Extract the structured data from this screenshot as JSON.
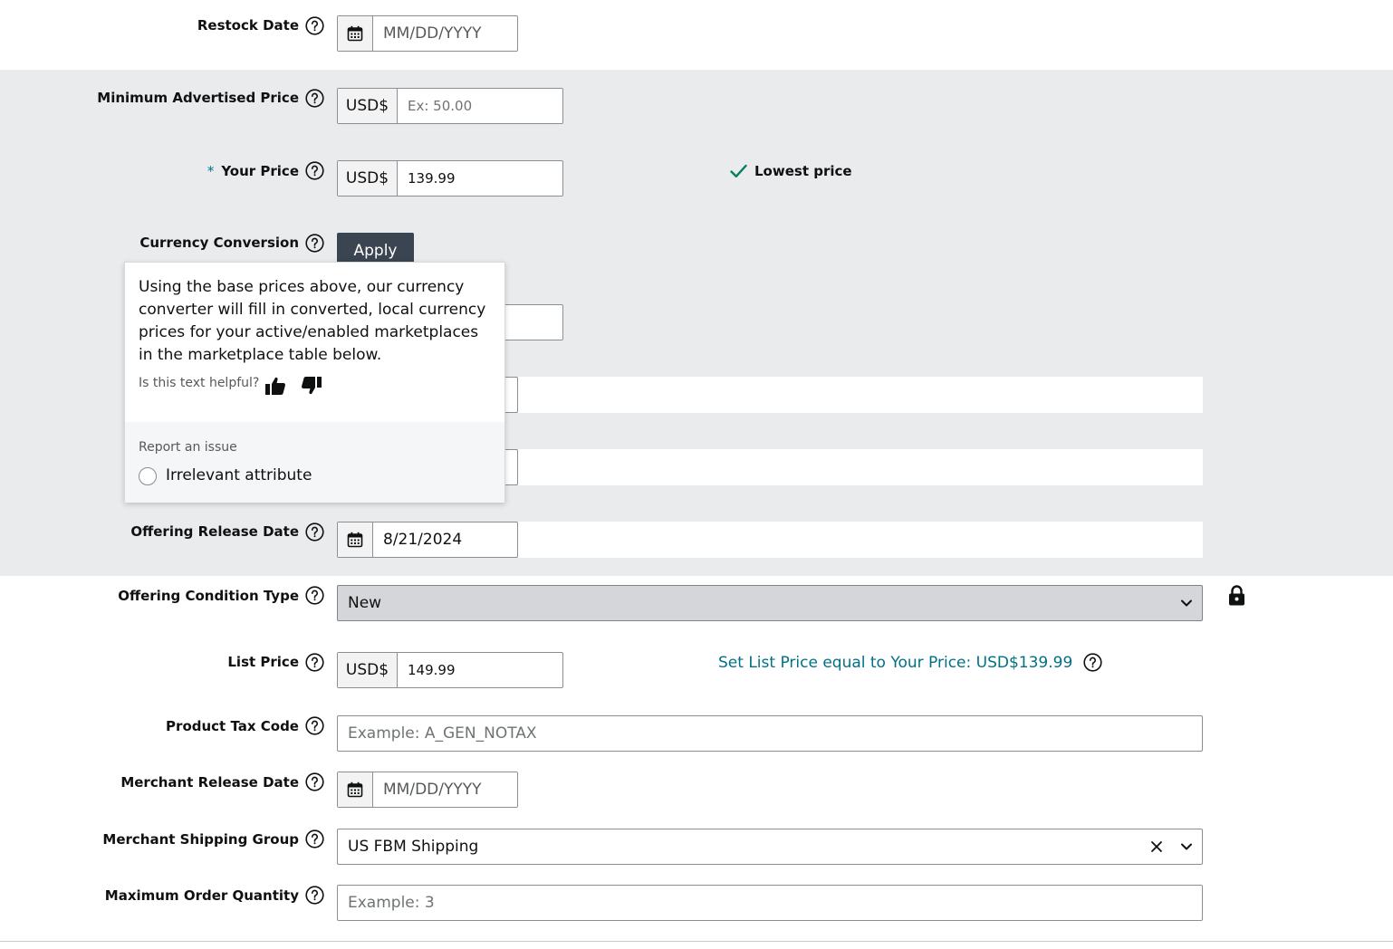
{
  "fields": {
    "restock_date": {
      "label": "Restock Date",
      "placeholder": "MM/DD/YYYY"
    },
    "min_adv_price": {
      "label": "Minimum Advertised Price",
      "currency": "USD$",
      "placeholder": "Ex: 50.00"
    },
    "your_price": {
      "required_mark": "*",
      "label": "Your Price",
      "currency": "USD$",
      "value": "139.99",
      "status": "Lowest price"
    },
    "currency_conversion": {
      "label": "Currency Conversion",
      "button": "Apply"
    },
    "offering_release_date": {
      "label": "Offering Release Date",
      "value": "8/21/2024"
    },
    "offering_condition_type": {
      "label": "Offering Condition Type",
      "value": "New"
    },
    "list_price": {
      "label": "List Price",
      "currency": "USD$",
      "value": "149.99",
      "link": "Set List Price equal to Your Price: USD$139.99"
    },
    "product_tax_code": {
      "label": "Product Tax Code",
      "placeholder": "Example: A_GEN_NOTAX"
    },
    "merchant_release_date": {
      "label": "Merchant Release Date",
      "placeholder": "MM/DD/YYYY"
    },
    "merchant_shipping_group": {
      "label": "Merchant Shipping Group",
      "value": "US FBM Shipping"
    },
    "max_order_quantity": {
      "label": "Maximum Order Quantity",
      "placeholder": "Example: 3"
    }
  },
  "popover": {
    "text": "Using the base prices above, our currency converter will fill in converted, local currency prices for your active/enabled marketplaces in the marketplace table below.",
    "helpful_prompt": "Is this text helpful?",
    "report_title": "Report an issue",
    "report_option": "Irrelevant attribute"
  },
  "colors": {
    "band": "#eaebed",
    "link": "#007185",
    "button": "#3b4551",
    "check": "#067d62"
  }
}
